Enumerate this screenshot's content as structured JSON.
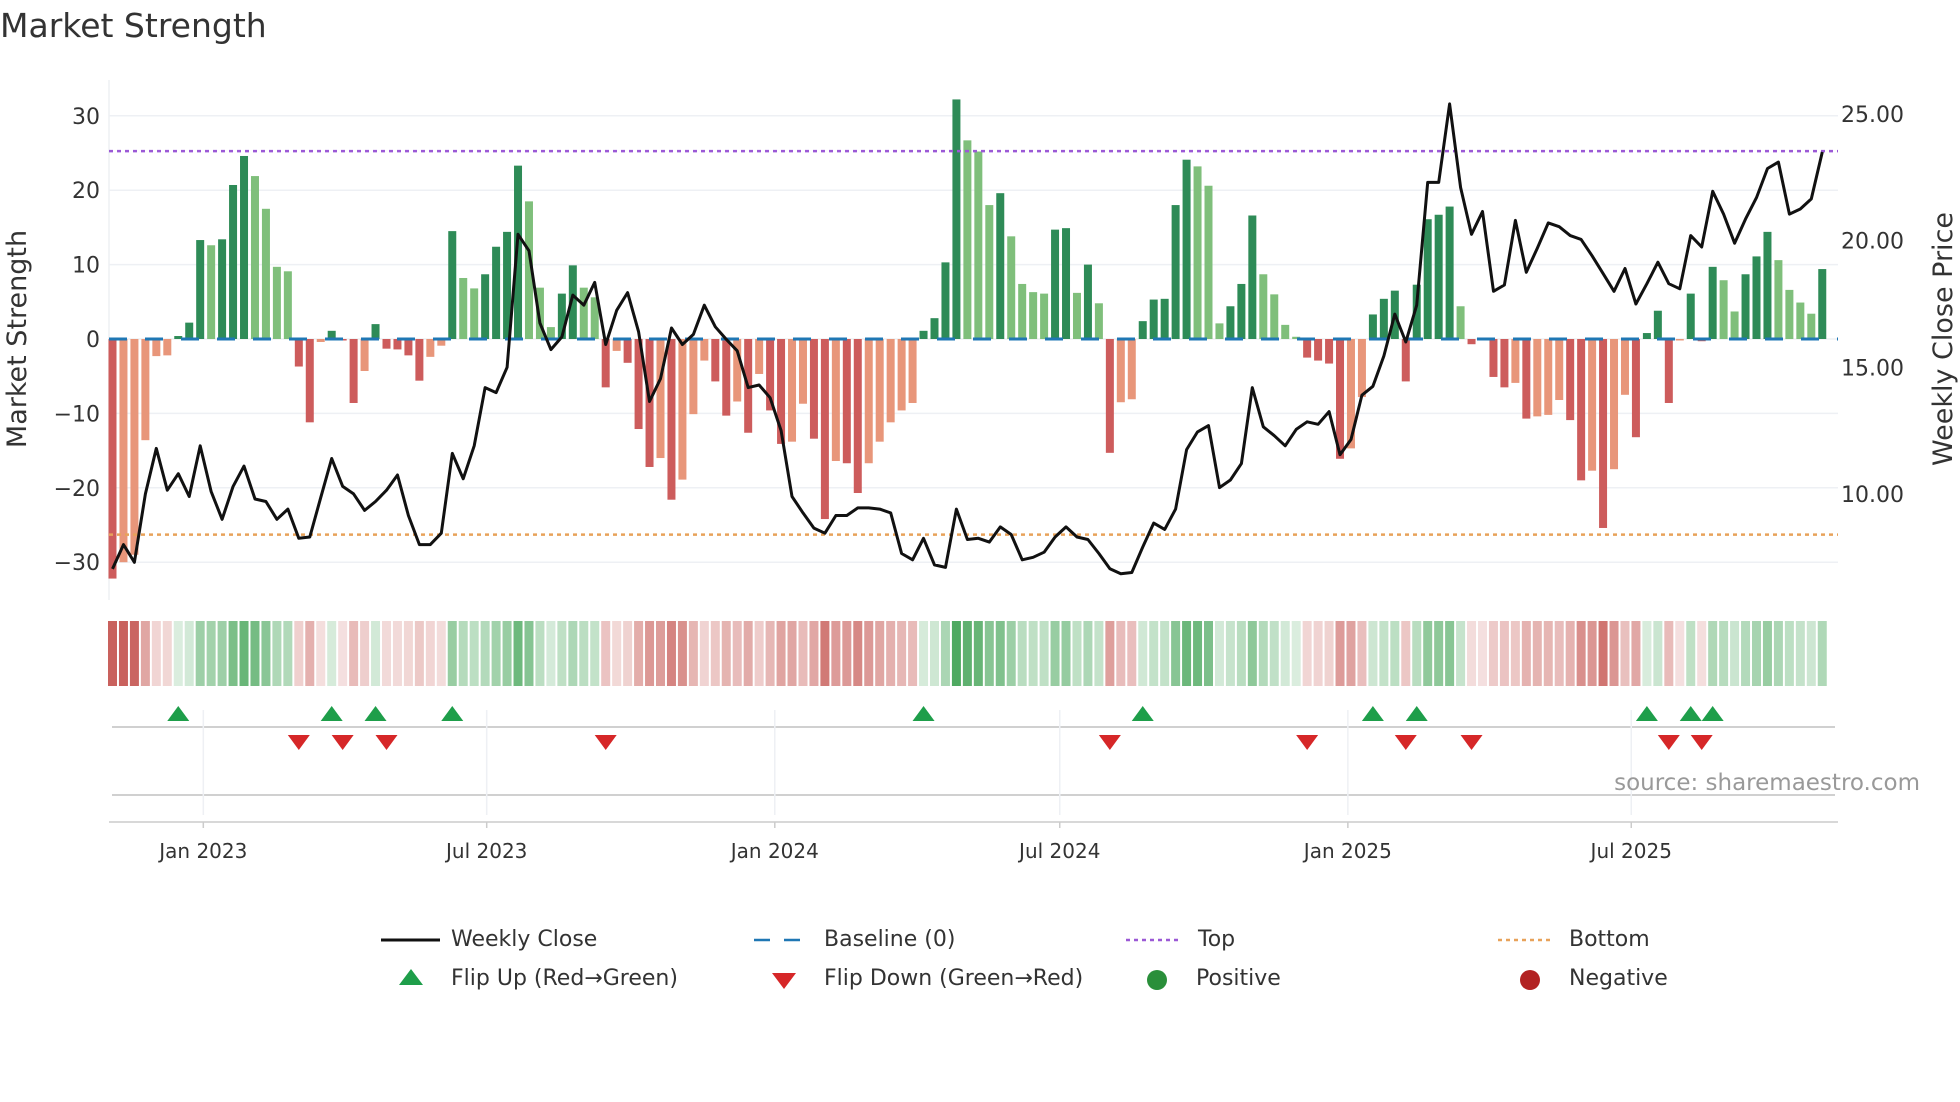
{
  "title": "Market Strength",
  "source": "source: sharemaestro.com",
  "legend": {
    "weekly_close": "Weekly Close",
    "baseline": "Baseline (0)",
    "top": "Top",
    "bottom": "Bottom",
    "flip_up": "Flip Up (Red→Green)",
    "flip_down": "Flip Down (Green→Red)",
    "positive": "Positive",
    "negative": "Negative"
  },
  "colors": {
    "strength_up_pos": "#2e8b57",
    "strength_down_pos": "#7fbf7b",
    "strength_down_neg": "#cd5c5c",
    "strength_up_neg": "#e8967a",
    "close": "#111111",
    "baseline": "#1f77b4",
    "top": "#9b59d6",
    "bottom": "#e8a25a",
    "flip_up": "#1e9e4a",
    "flip_down": "#d62728",
    "positive": "#2a8f3a",
    "negative": "#b22222"
  },
  "chart_data": {
    "type": "bar+line",
    "title": "Market Strength",
    "ylabel": "Market Strength",
    "y2label": "Weekly Close Price",
    "ylim": [
      -35,
      35
    ],
    "y2lim": [
      6.2,
      25.9
    ],
    "yticks": [
      -30,
      -20,
      -10,
      0,
      10,
      20,
      30
    ],
    "ytick_labels": [
      "−30",
      "−20",
      "−10",
      "0",
      "10",
      "20",
      "30"
    ],
    "y2ticks": [
      10,
      15,
      20,
      25
    ],
    "y2tick_labels": [
      "10.00",
      "15.00",
      "20.00",
      "25.00"
    ],
    "xticks": [
      {
        "date": "2023-01-01",
        "label": "Jan 2023"
      },
      {
        "date": "2023-07-01",
        "label": "Jul 2023"
      },
      {
        "date": "2024-01-01",
        "label": "Jan 2024"
      },
      {
        "date": "2024-07-01",
        "label": "Jul 2024"
      },
      {
        "date": "2025-01-01",
        "label": "Jan 2025"
      },
      {
        "date": "2025-07-01",
        "label": "Jul 2025"
      }
    ],
    "start_date": "2022-11-04",
    "frequency": "weekly",
    "top": 25.26,
    "bottom": -26.3,
    "baseline": 0,
    "grid": true,
    "legend_position": "bottom",
    "strength": [
      -32.2,
      -30,
      -29,
      -13.6,
      -2.3,
      -2.2,
      0.4,
      2.2,
      13.3,
      12.6,
      13.4,
      20.7,
      24.6,
      21.9,
      17.5,
      9.7,
      9.1,
      -3.7,
      -11.2,
      -0.4,
      1.1,
      -0.2,
      -8.6,
      -4.3,
      2.0,
      -1.3,
      -1.4,
      -2.2,
      -5.6,
      -2.4,
      -0.9,
      14.5,
      8.2,
      6.8,
      8.7,
      12.4,
      14.4,
      23.3,
      18.5,
      6.9,
      1.6,
      6.1,
      9.9,
      6.9,
      5.6,
      -6.5,
      -1.6,
      -3.2,
      -12.1,
      -17.2,
      -16,
      -21.6,
      -18.9,
      -10.1,
      -2.9,
      -5.7,
      -10.3,
      -8.4,
      -12.6,
      -4.7,
      -9.6,
      -14.1,
      -13.8,
      -8.7,
      -13.4,
      -24.2,
      -16.4,
      -16.7,
      -20.7,
      -16.7,
      -13.8,
      -11.2,
      -9.6,
      -8.6,
      1.1,
      2.8,
      10.3,
      32.2,
      26.7,
      25.2,
      18.0,
      19.6,
      13.8,
      7.4,
      6.3,
      6.1,
      14.7,
      14.9,
      6.2,
      10.0,
      4.8,
      -15.3,
      -8.5,
      -8.1,
      2.4,
      5.3,
      5.4,
      18.0,
      24.1,
      23.2,
      20.6,
      2.1,
      4.4,
      7.4,
      16.6,
      8.7,
      6.0,
      1.9,
      0.3,
      -2.5,
      -2.9,
      -3.3,
      -16.1,
      -14.7,
      -7.8,
      3.3,
      5.4,
      6.5,
      -5.7,
      7.3,
      16.1,
      16.7,
      17.8,
      4.4,
      -0.7,
      -0.1,
      -5.1,
      -6.5,
      -5.9,
      -10.7,
      -10.4,
      -10.2,
      -8.2,
      -10.9,
      -19.0,
      -17.7,
      -25.4,
      -17.5,
      -7.5,
      -13.2,
      0.8,
      3.8,
      -8.6,
      -0.2,
      6.1,
      -0.3,
      9.7,
      7.9,
      3.7,
      8.7,
      11.1,
      14.4,
      10.6,
      6.6,
      4.9,
      3.4,
      9.4
    ],
    "weekly_close": [
      7.04,
      8.0,
      7.3,
      10.0,
      11.8,
      10.15,
      10.8,
      9.9,
      11.9,
      10.1,
      9.0,
      10.3,
      11.1,
      9.8,
      9.7,
      9.0,
      9.4,
      8.25,
      8.3,
      9.85,
      11.4,
      10.3,
      10.0,
      9.35,
      9.7,
      10.15,
      10.75,
      9.15,
      8.0,
      8.0,
      8.45,
      11.6,
      10.6,
      11.9,
      14.2,
      14.0,
      15.0,
      20.25,
      19.6,
      16.75,
      15.7,
      16.2,
      17.85,
      17.45,
      18.35,
      15.9,
      17.25,
      17.95,
      16.4,
      13.65,
      14.55,
      16.55,
      15.9,
      16.3,
      17.45,
      16.6,
      16.1,
      15.65,
      14.2,
      14.3,
      13.8,
      12.5,
      9.9,
      9.25,
      8.65,
      8.45,
      9.15,
      9.15,
      9.45,
      9.45,
      9.4,
      9.25,
      7.65,
      7.4,
      8.25,
      7.2,
      7.1,
      9.4,
      8.2,
      8.25,
      8.1,
      8.7,
      8.4,
      7.4,
      7.5,
      7.7,
      8.3,
      8.7,
      8.3,
      8.2,
      7.65,
      7.05,
      6.85,
      6.9,
      7.9,
      8.85,
      8.6,
      9.4,
      11.75,
      12.45,
      12.7,
      10.25,
      10.55,
      11.2,
      14.2,
      12.65,
      12.3,
      11.9,
      12.55,
      12.85,
      12.75,
      13.25,
      11.55,
      12.15,
      13.9,
      14.25,
      15.45,
      17.1,
      16.0,
      17.45,
      22.3,
      22.3,
      25.4,
      22.1,
      20.25,
      21.15,
      18.0,
      18.25,
      20.8,
      18.75,
      19.7,
      20.7,
      20.55,
      20.2,
      20.05,
      19.4,
      18.7,
      18.0,
      18.9,
      17.5,
      18.3,
      19.15,
      18.3,
      18.1,
      20.2,
      19.75,
      21.95,
      21.05,
      19.9,
      20.85,
      21.7,
      22.85,
      23.1,
      21.05,
      21.25,
      21.65,
      23.5
    ]
  }
}
